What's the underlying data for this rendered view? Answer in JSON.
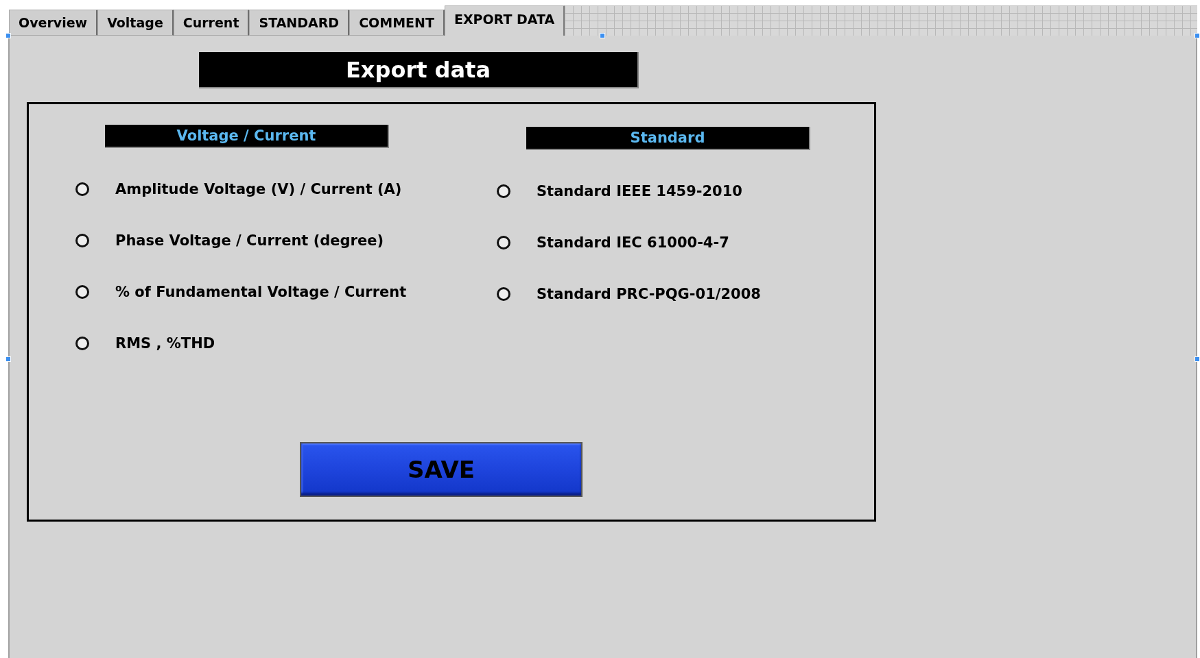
{
  "tabs": [
    {
      "label": "Overview",
      "selected": false
    },
    {
      "label": "Voltage",
      "selected": false
    },
    {
      "label": "Current",
      "selected": false
    },
    {
      "label": "STANDARD",
      "selected": false
    },
    {
      "label": "COMMENT",
      "selected": false
    },
    {
      "label": "EXPORT DATA",
      "selected": true
    }
  ],
  "title": "Export data",
  "groups": [
    {
      "heading": "Voltage / Current",
      "options": [
        {
          "label": "Amplitude Voltage (V) / Current (A)",
          "selected": false
        },
        {
          "label": "Phase Voltage / Current (degree)",
          "selected": false
        },
        {
          "label": "% of Fundamental Voltage / Current",
          "selected": false
        },
        {
          "label": "RMS , %THD",
          "selected": false
        }
      ]
    },
    {
      "heading": "Standard",
      "options": [
        {
          "label": "Standard IEEE 1459-2010",
          "selected": false
        },
        {
          "label": "Standard IEC 61000-4-7",
          "selected": false
        },
        {
          "label": "Standard PRC-PQG-01/2008",
          "selected": false
        }
      ]
    }
  ],
  "save_button": "SAVE"
}
